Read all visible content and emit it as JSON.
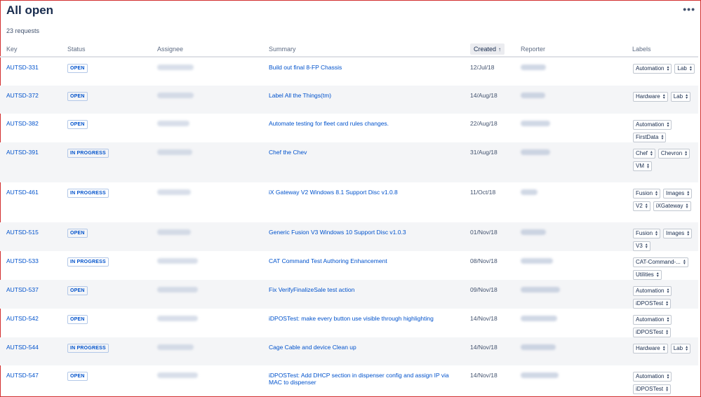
{
  "page": {
    "title": "All open",
    "more_label": "•••",
    "request_count": "23 requests"
  },
  "columns": {
    "key": "Key",
    "status": "Status",
    "assignee": "Assignee",
    "summary": "Summary",
    "created": "Created",
    "created_sort": "↑",
    "reporter": "Reporter",
    "labels": "Labels"
  },
  "rows": [
    {
      "key": "AUTSD-331",
      "status": "OPEN",
      "summary": "Build out final 8-FP Chassis",
      "created": "12/Jul/18",
      "labels": [
        "Automation",
        "Lab"
      ]
    },
    {
      "key": "AUTSD-372",
      "status": "OPEN",
      "summary": "Label All the Things(tm)",
      "created": "14/Aug/18",
      "labels": [
        "Hardware",
        "Lab"
      ]
    },
    {
      "key": "AUTSD-382",
      "status": "OPEN",
      "summary": "Automate testing for fleet card rules changes.",
      "created": "22/Aug/18",
      "labels": [
        "Automation",
        "FirstData"
      ]
    },
    {
      "key": "AUTSD-391",
      "status": "IN PROGRESS",
      "summary": "Chef the Chev",
      "created": "31/Aug/18",
      "labels": [
        "Chef",
        "Chevron",
        "VM"
      ]
    },
    {
      "key": "AUTSD-461",
      "status": "IN PROGRESS",
      "summary": "iX Gateway V2 Windows 8.1 Support Disc v1.0.8",
      "created": "11/Oct/18",
      "labels": [
        "Fusion",
        "Images",
        "V2",
        "iXGateway"
      ]
    },
    {
      "key": "AUTSD-515",
      "status": "OPEN",
      "summary": "Generic Fusion V3 Windows 10 Support Disc v1.0.3",
      "created": "01/Nov/18",
      "labels": [
        "Fusion",
        "Images",
        "V3"
      ]
    },
    {
      "key": "AUTSD-533",
      "status": "IN PROGRESS",
      "summary": "CAT Command Test Authoring Enhancement",
      "created": "08/Nov/18",
      "labels": [
        "CAT-Command-...",
        "Utilities"
      ]
    },
    {
      "key": "AUTSD-537",
      "status": "OPEN",
      "summary": "Fix VerifyFinalizeSale test action",
      "created": "09/Nov/18",
      "labels": [
        "Automation",
        "iDPOSTest"
      ]
    },
    {
      "key": "AUTSD-542",
      "status": "OPEN",
      "summary": "iDPOSTest: make every button use visible through highlighting",
      "created": "14/Nov/18",
      "labels": [
        "Automation",
        "iDPOSTest"
      ]
    },
    {
      "key": "AUTSD-544",
      "status": "IN PROGRESS",
      "summary": "Cage Cable and device Clean up",
      "created": "14/Nov/18",
      "labels": [
        "Hardware",
        "Lab"
      ]
    },
    {
      "key": "AUTSD-547",
      "status": "OPEN",
      "summary": "iDPOSTest: Add DHCP section in dispenser config and assign IP via MAC to dispenser",
      "created": "14/Nov/18",
      "labels": [
        "Automation",
        "iDPOSTest"
      ]
    }
  ]
}
